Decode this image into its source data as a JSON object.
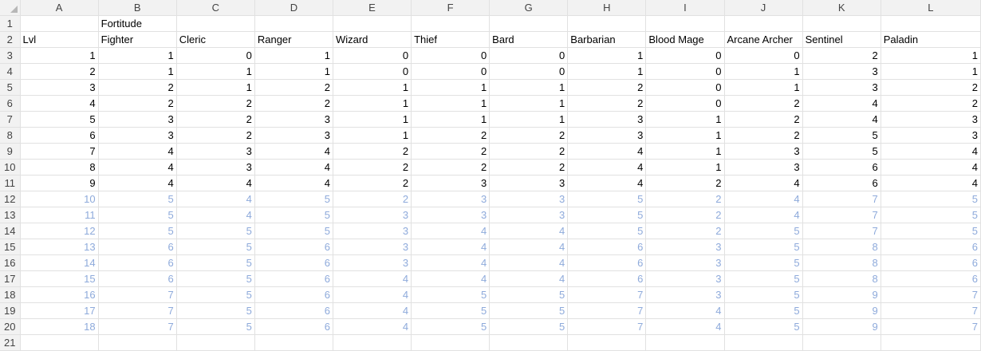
{
  "columns": [
    "A",
    "B",
    "C",
    "D",
    "E",
    "F",
    "G",
    "H",
    "I",
    "J",
    "K",
    "L"
  ],
  "title_cell": "Fortitude",
  "headers": [
    "Lvl",
    "Fighter",
    "Cleric",
    "Ranger",
    "Wizard",
    "Thief",
    "Bard",
    "Barbarian",
    "Blood Mage",
    "Arcane Archer",
    "Sentinel",
    "Paladin"
  ],
  "rows": [
    {
      "rn": "3",
      "vals": [
        "1",
        "1",
        "0",
        "1",
        "0",
        "0",
        "0",
        "1",
        "0",
        "0",
        "2",
        "1"
      ]
    },
    {
      "rn": "4",
      "vals": [
        "2",
        "1",
        "1",
        "1",
        "0",
        "0",
        "0",
        "1",
        "0",
        "1",
        "3",
        "1"
      ]
    },
    {
      "rn": "5",
      "vals": [
        "3",
        "2",
        "1",
        "2",
        "1",
        "1",
        "1",
        "2",
        "0",
        "1",
        "3",
        "2"
      ]
    },
    {
      "rn": "6",
      "vals": [
        "4",
        "2",
        "2",
        "2",
        "1",
        "1",
        "1",
        "2",
        "0",
        "2",
        "4",
        "2"
      ]
    },
    {
      "rn": "7",
      "vals": [
        "5",
        "3",
        "2",
        "3",
        "1",
        "1",
        "1",
        "3",
        "1",
        "2",
        "4",
        "3"
      ]
    },
    {
      "rn": "8",
      "vals": [
        "6",
        "3",
        "2",
        "3",
        "1",
        "2",
        "2",
        "3",
        "1",
        "2",
        "5",
        "3"
      ]
    },
    {
      "rn": "9",
      "vals": [
        "7",
        "4",
        "3",
        "4",
        "2",
        "2",
        "2",
        "4",
        "1",
        "3",
        "5",
        "4"
      ]
    },
    {
      "rn": "10",
      "vals": [
        "8",
        "4",
        "3",
        "4",
        "2",
        "2",
        "2",
        "4",
        "1",
        "3",
        "6",
        "4"
      ]
    },
    {
      "rn": "11",
      "vals": [
        "9",
        "4",
        "4",
        "4",
        "2",
        "3",
        "3",
        "4",
        "2",
        "4",
        "6",
        "4"
      ]
    },
    {
      "rn": "12",
      "vals": [
        "10",
        "5",
        "4",
        "5",
        "2",
        "3",
        "3",
        "5",
        "2",
        "4",
        "7",
        "5"
      ]
    },
    {
      "rn": "13",
      "vals": [
        "11",
        "5",
        "4",
        "5",
        "3",
        "3",
        "3",
        "5",
        "2",
        "4",
        "7",
        "5"
      ]
    },
    {
      "rn": "14",
      "vals": [
        "12",
        "5",
        "5",
        "5",
        "3",
        "4",
        "4",
        "5",
        "2",
        "5",
        "7",
        "5"
      ]
    },
    {
      "rn": "15",
      "vals": [
        "13",
        "6",
        "5",
        "6",
        "3",
        "4",
        "4",
        "6",
        "3",
        "5",
        "8",
        "6"
      ]
    },
    {
      "rn": "16",
      "vals": [
        "14",
        "6",
        "5",
        "6",
        "3",
        "4",
        "4",
        "6",
        "3",
        "5",
        "8",
        "6"
      ]
    },
    {
      "rn": "17",
      "vals": [
        "15",
        "6",
        "5",
        "6",
        "4",
        "4",
        "4",
        "6",
        "3",
        "5",
        "8",
        "6"
      ]
    },
    {
      "rn": "18",
      "vals": [
        "16",
        "7",
        "5",
        "6",
        "4",
        "5",
        "5",
        "7",
        "3",
        "5",
        "9",
        "7"
      ]
    },
    {
      "rn": "19",
      "vals": [
        "17",
        "7",
        "5",
        "6",
        "4",
        "5",
        "5",
        "7",
        "4",
        "5",
        "9",
        "7"
      ]
    },
    {
      "rn": "20",
      "vals": [
        "18",
        "7",
        "5",
        "6",
        "4",
        "5",
        "5",
        "7",
        "4",
        "5",
        "9",
        "7"
      ]
    }
  ],
  "projected_from_row": 12,
  "colors": {
    "projected_text": "#8eaadb",
    "normal_text": "#000000",
    "header_bg": "#f2f2f2",
    "gridline": "#e1e1e1"
  },
  "row_labels": {
    "r1": "1",
    "r2": "2",
    "r21": "21"
  }
}
